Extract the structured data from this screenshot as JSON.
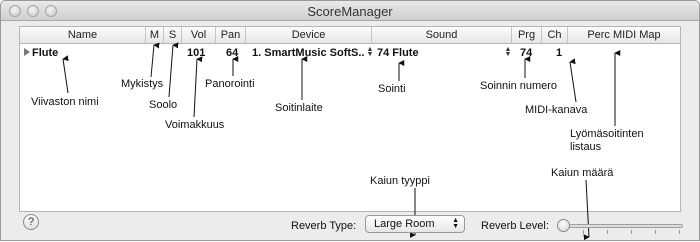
{
  "window": {
    "title": "ScoreManager"
  },
  "columns": [
    "Name",
    "M",
    "S",
    "Vol",
    "Pan",
    "Device",
    "Sound",
    "Prg",
    "Ch",
    "Perc MIDI Map"
  ],
  "row": {
    "name": "Flute",
    "vol": "101",
    "pan": "64",
    "device": "1. SmartMusic SoftS...",
    "sound": "74 Flute",
    "prg": "74",
    "ch": "1"
  },
  "annotations": {
    "staff_name": "Viivaston nimi",
    "mute": "Mykistys",
    "solo": "Soolo",
    "volume": "Voimakkuus",
    "panning": "Panorointi",
    "device": "Soitinlaite",
    "sound": "Sointi",
    "program_number": "Soinnin numero",
    "midi_channel": "MIDI-kanava",
    "perc_map_line1": "Lyömäsoitinten",
    "perc_map_line2": "listaus",
    "reverb_type": "Kaiun tyyppi",
    "reverb_amount": "Kaiun määrä"
  },
  "footer": {
    "help": "?",
    "reverb_type_label": "Reverb Type:",
    "reverb_type_value": "Large Room",
    "reverb_level_label": "Reverb Level:",
    "reverb_level": 0
  }
}
